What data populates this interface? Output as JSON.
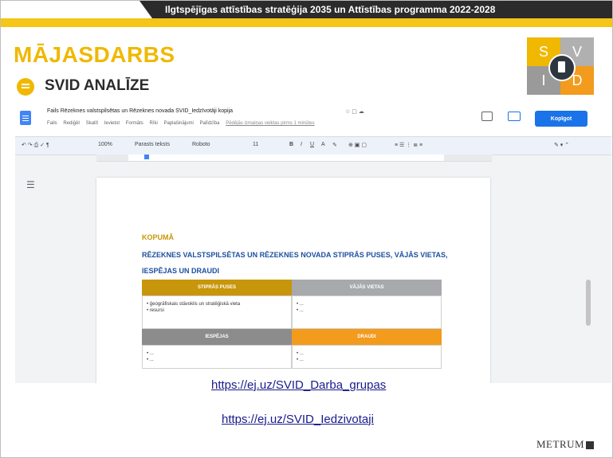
{
  "banner": {
    "text": "Ilgtspējīgas attīstības stratēģija 2035 un Attīstības programma 2022-2028"
  },
  "slide": {
    "title": "MĀJASDARBS",
    "subtitle": "SVID ANALĪZE"
  },
  "svid_logo": {
    "s": "S",
    "v": "V",
    "i": "I",
    "d": "D"
  },
  "gdocs": {
    "doc_title": "Fails Rēzeknes valstspilsētas un Rēzeknes novada SVID_Iedzīvotāji kopija",
    "menu": [
      "Fails",
      "Rediģēt",
      "Skatīt",
      "Ievietot",
      "Formāts",
      "Rīki",
      "Paplašinājumi",
      "Palīdzība"
    ],
    "last_edit": "Pēdējās izmaiņas veiktas pirms 1 minūtes",
    "share_label": "Kopīgot",
    "zoom": "100%",
    "style": "Parasts teksts",
    "font": "Roboto",
    "font_size": "11"
  },
  "doc": {
    "section": "KOPUMĀ",
    "heading": "RĒZEKNES VALSTSPILSĒTAS UN RĒZEKNES NOVADA STIPRĀS PUSES, VĀJĀS VIETAS, IESPĒJAS UN DRAUDI",
    "swot": {
      "strengths_label": "STIPRĀS PUSES",
      "weaknesses_label": "VĀJĀS VIETAS",
      "opportunities_label": "IESPĒJAS",
      "threats_label": "DRAUDI",
      "strengths_items": [
        "ģeogrāfiskais stāvoklis un stratēģiskā vieta",
        "resursi"
      ],
      "weaknesses_items": [
        "...",
        "..."
      ],
      "opportunities_items": [
        "...",
        "..."
      ],
      "threats_items": [
        "...",
        "..."
      ]
    }
  },
  "links": {
    "link1": "https://ej.uz/SVID_Darba_grupas",
    "link2": "https://ej.uz/SVID_Iedzivotaji"
  },
  "footer": {
    "logo": "METRUM"
  }
}
